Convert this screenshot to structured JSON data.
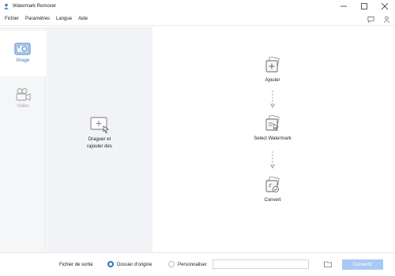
{
  "window": {
    "title": "Watermark Remover",
    "icon": "app-logo-icon",
    "controls": [
      "minimize-icon",
      "maximize-icon",
      "close-icon"
    ]
  },
  "menu": {
    "items": [
      "Fichier",
      "Paramètres",
      "Langue",
      "Aide"
    ],
    "right_icons": [
      "chat-icon",
      "user-icon"
    ]
  },
  "sidebar": {
    "items": [
      {
        "label": "Image",
        "icon": "image-icon",
        "active": true
      },
      {
        "label": "Vidéo",
        "icon": "video-camera-icon",
        "active": false
      }
    ]
  },
  "drop_area": {
    "text": "Draguer et rajouter des",
    "icon": "add-image-icon"
  },
  "steps": [
    {
      "label": "Ajouter",
      "icon": "add-files-icon"
    },
    {
      "label": "Select Watermark",
      "icon": "select-watermark-icon"
    },
    {
      "label": "Convert",
      "icon": "convert-icon"
    }
  ],
  "output": {
    "label": "Fichier de sortie",
    "options": [
      {
        "label": "Dossier d'origine",
        "selected": true
      },
      {
        "label": "Personnaliser",
        "selected": false
      }
    ],
    "path_value": "",
    "folder_icon": "folder-icon",
    "convert_label": "Convertir"
  },
  "colors": {
    "accent": "#2f6fc4",
    "convert_button": "#a9c9f3",
    "sidebar_bg": "#f5f6f8",
    "drop_bg": "#f1f3f7"
  }
}
